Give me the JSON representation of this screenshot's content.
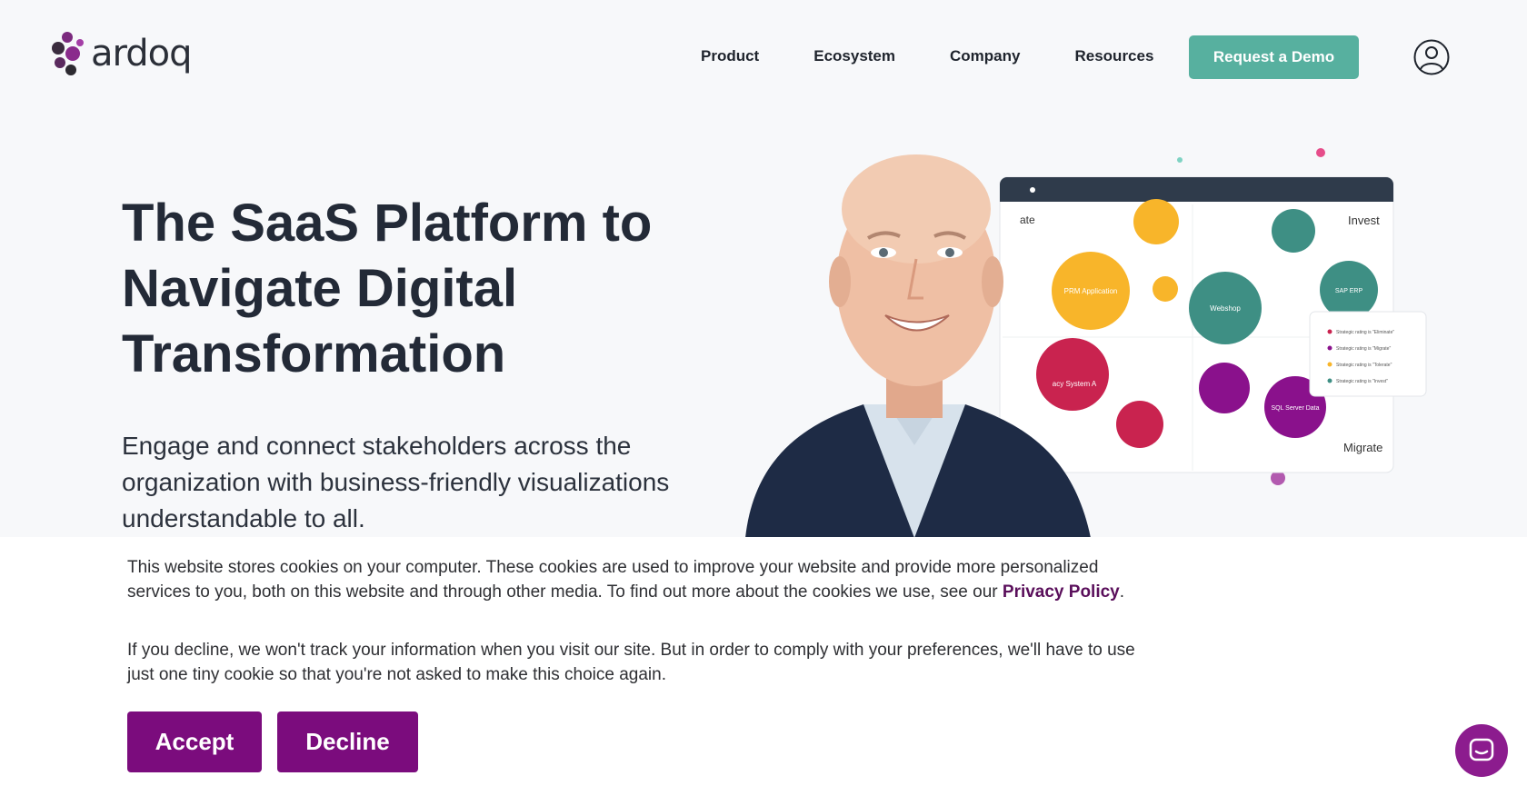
{
  "brand": {
    "name": "ardoq",
    "logo_icon": "ardoq-logo-icon",
    "accent": "#57b09f",
    "cookie_accent": "#7b0c7d"
  },
  "nav": {
    "items": [
      {
        "label": "Product"
      },
      {
        "label": "Ecosystem"
      },
      {
        "label": "Company"
      },
      {
        "label": "Resources"
      }
    ],
    "cta_label": "Request a Demo",
    "account_icon": "user-circle-icon"
  },
  "hero": {
    "title_line1": "The SaaS Platform to",
    "title_line2": "Navigate Digital",
    "title_line3": "Transformation",
    "subtitle": "Engage and connect stakeholders across the organization with business-friendly visualizations understandable to all."
  },
  "visual": {
    "quadrant_labels": [
      "ate",
      "Invest",
      "Migrate"
    ],
    "bubbles": [
      "PRM Application",
      "Webshop",
      "SAP ERP",
      "acy System A",
      "SQL Server Data"
    ],
    "legend_items": [
      "Strategic rating is \"Eliminate\"",
      "Strategic rating is \"Migrate\"",
      "Strategic rating is \"Tolerate\"",
      "Strategic rating is \"Invest\""
    ]
  },
  "cookie": {
    "text1": "This website stores cookies on your computer. These cookies are used to improve your website and provide more personalized services to you, both on this website and through other media. To find out more about the cookies we use, see our ",
    "privacy_label": "Privacy Policy",
    "text1_end": ".",
    "text2": "If you decline, we won't track your information when you visit our site. But in order to comply with your preferences, we'll have to use just one tiny cookie so that you're not asked to make this choice again.",
    "accept_label": "Accept",
    "decline_label": "Decline"
  },
  "chat": {
    "icon": "chat-icon"
  }
}
